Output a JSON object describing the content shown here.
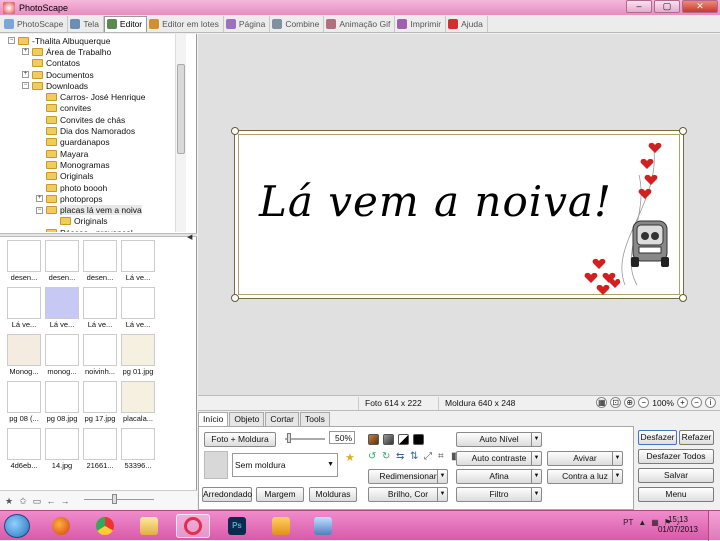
{
  "window": {
    "title": "PhotoScape",
    "min": "–",
    "max": "▢",
    "close": "✕"
  },
  "tabs": [
    {
      "label": "PhotoScape",
      "icon": "photoscape-icon",
      "color": "#7aa6d8"
    },
    {
      "label": "Tela",
      "icon": "viewer-icon",
      "color": "#6b8fb0"
    },
    {
      "label": "Editor",
      "icon": "editor-icon",
      "color": "#5a8a50"
    },
    {
      "label": "Editor em lotes",
      "icon": "batch-editor-icon",
      "color": "#d09030"
    },
    {
      "label": "Página",
      "icon": "page-icon",
      "color": "#a070c0"
    },
    {
      "label": "Combine",
      "icon": "combine-icon",
      "color": "#8090a0"
    },
    {
      "label": "Animação Gif",
      "icon": "gif-icon",
      "color": "#b07080"
    },
    {
      "label": "Imprimir",
      "icon": "print-icon",
      "color": "#a060b0"
    },
    {
      "label": "Ajuda",
      "icon": "help-icon",
      "color": "#d03030"
    }
  ],
  "tree": [
    {
      "label": "-Thalita Albuquerque",
      "depth": 1,
      "exp": "−"
    },
    {
      "label": "Área de Trabalho",
      "depth": 2,
      "exp": "+"
    },
    {
      "label": "Contatos",
      "depth": 2,
      "exp": ""
    },
    {
      "label": "Documentos",
      "depth": 2,
      "exp": "+"
    },
    {
      "label": "Downloads",
      "depth": 2,
      "exp": "−"
    },
    {
      "label": "Carros- José Henrique",
      "depth": 3,
      "exp": ""
    },
    {
      "label": "convites",
      "depth": 3,
      "exp": ""
    },
    {
      "label": "Convites de chás",
      "depth": 3,
      "exp": ""
    },
    {
      "label": "Dia dos Namorados",
      "depth": 3,
      "exp": ""
    },
    {
      "label": "guardanapos",
      "depth": 3,
      "exp": ""
    },
    {
      "label": "Mayara",
      "depth": 3,
      "exp": ""
    },
    {
      "label": "Monogramas",
      "depth": 3,
      "exp": ""
    },
    {
      "label": "Originals",
      "depth": 3,
      "exp": ""
    },
    {
      "label": "photo boooh",
      "depth": 3,
      "exp": ""
    },
    {
      "label": "photoprops",
      "depth": 3,
      "exp": "+"
    },
    {
      "label": "placas lá vem a noiva",
      "depth": 3,
      "exp": "−",
      "selected": true
    },
    {
      "label": "Originals",
      "depth": 4,
      "exp": ""
    },
    {
      "label": "Páscoa - provençal",
      "depth": 3,
      "exp": ""
    }
  ],
  "thumbnails": [
    "desen...",
    "desen...",
    "desen...",
    "Lá ve...",
    "Lá ve...",
    "Lá ve...",
    "Lá ve...",
    "Lá ve...",
    "Monog...",
    "monog...",
    "noivinh...",
    "pg 01.jpg",
    "pg 08 (...",
    "pg 08.jpg",
    "pg 17.jpg",
    "placala...",
    "4d6eb...",
    "14.jpg",
    "21661...",
    "53396..."
  ],
  "canvas": {
    "banner_text": "Lá vem a noiva!"
  },
  "status": {
    "photo": "Foto 614 x 222",
    "frame": "Moldura 640 x 248",
    "zoom": "100%"
  },
  "panel": {
    "tabs": [
      "Início",
      "Objeto",
      "Cortar",
      "Tools"
    ],
    "foto_moldura": "Foto + Moldura",
    "percent": "50%",
    "frame_select": "Sem moldura",
    "arredondado": "Arredondado",
    "margem": "Margem",
    "molduras": "Molduras",
    "redimensionar": "Redimensionar",
    "brilho_cor": "Brilho, Cor",
    "auto_nivel": "Auto Nível",
    "auto_contraste": "Auto contraste",
    "afina": "Afina",
    "filtro": "Filtro",
    "avivar": "Avivar",
    "contra_luz": "Contra a luz"
  },
  "right_buttons": {
    "desfazer": "Desfazer",
    "refazer": "Refazer",
    "desfazer_todos": "Desfazer Todos",
    "salvar": "Salvar",
    "menu": "Menu"
  },
  "taskbar": {
    "lang": "PT",
    "time": "15:13",
    "date": "01/07/2013"
  },
  "colors": {
    "taskbar": "#e070b8",
    "titlebar": "#efa5cf",
    "canvas_bg": "#e0e0e0",
    "heart": "#d02020"
  }
}
